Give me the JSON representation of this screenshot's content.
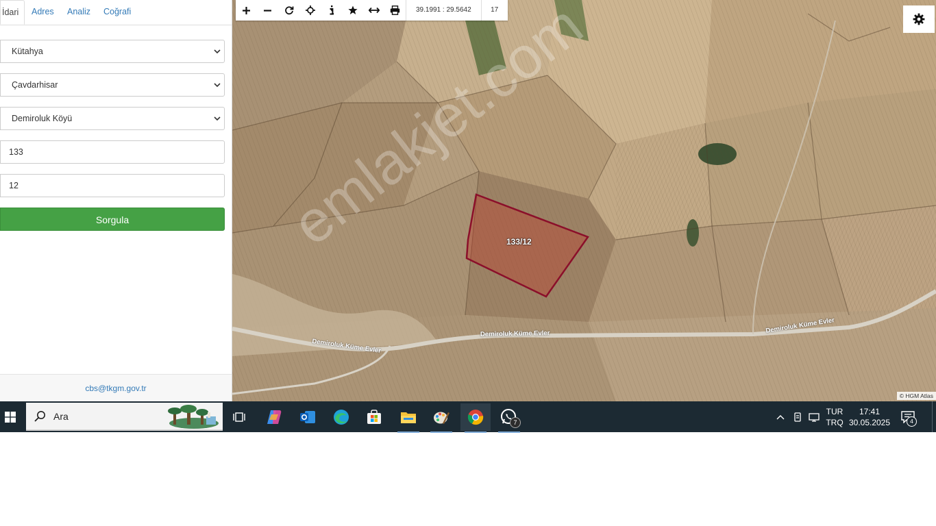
{
  "tabs": [
    {
      "label": "İdari",
      "active": true
    },
    {
      "label": "Adres",
      "active": false
    },
    {
      "label": "Analiz",
      "active": false
    },
    {
      "label": "Coğrafi",
      "active": false
    }
  ],
  "form": {
    "province": "Kütahya",
    "district": "Çavdarhisar",
    "neighborhood": "Demiroluk Köyü",
    "block": "133",
    "parcel": "12",
    "submit_label": "Sorgula"
  },
  "footer": {
    "email": "cbs@tkgm.gov.tr"
  },
  "map": {
    "toolbar_icons": [
      "zoom-in-icon",
      "zoom-out-icon",
      "refresh-icon",
      "locate-icon",
      "info-icon",
      "favorite-icon",
      "measure-icon",
      "print-icon"
    ],
    "coordinates": "39.1991 : 29.5642",
    "zoom_level": "17",
    "parcel_label": "133/12",
    "road_labels": [
      "Demiroluk Küme Evler",
      "Demiroluk Küme Evler",
      "Demiroluk Küme Evler"
    ],
    "watermark": "emlakjet.com",
    "attribution": "© HGM Atlas",
    "settings_icon": "gear-icon",
    "colors": {
      "parcel_stroke": "#8b0f2a",
      "parcel_fill": "#c0392b",
      "button_green": "#45a145"
    }
  },
  "taskbar": {
    "search_placeholder": "Ara",
    "apps": [
      "task-view-icon",
      "copilot-icon",
      "outlook-icon",
      "edge-icon",
      "store-icon",
      "file-explorer-icon",
      "paint-icon",
      "chrome-icon",
      "whatsapp-icon"
    ],
    "whatsapp_badge": "7",
    "language_top": "TUR",
    "language_bottom": "TRQ",
    "time": "17:41",
    "date": "30.05.2025",
    "notification_count": "4"
  }
}
